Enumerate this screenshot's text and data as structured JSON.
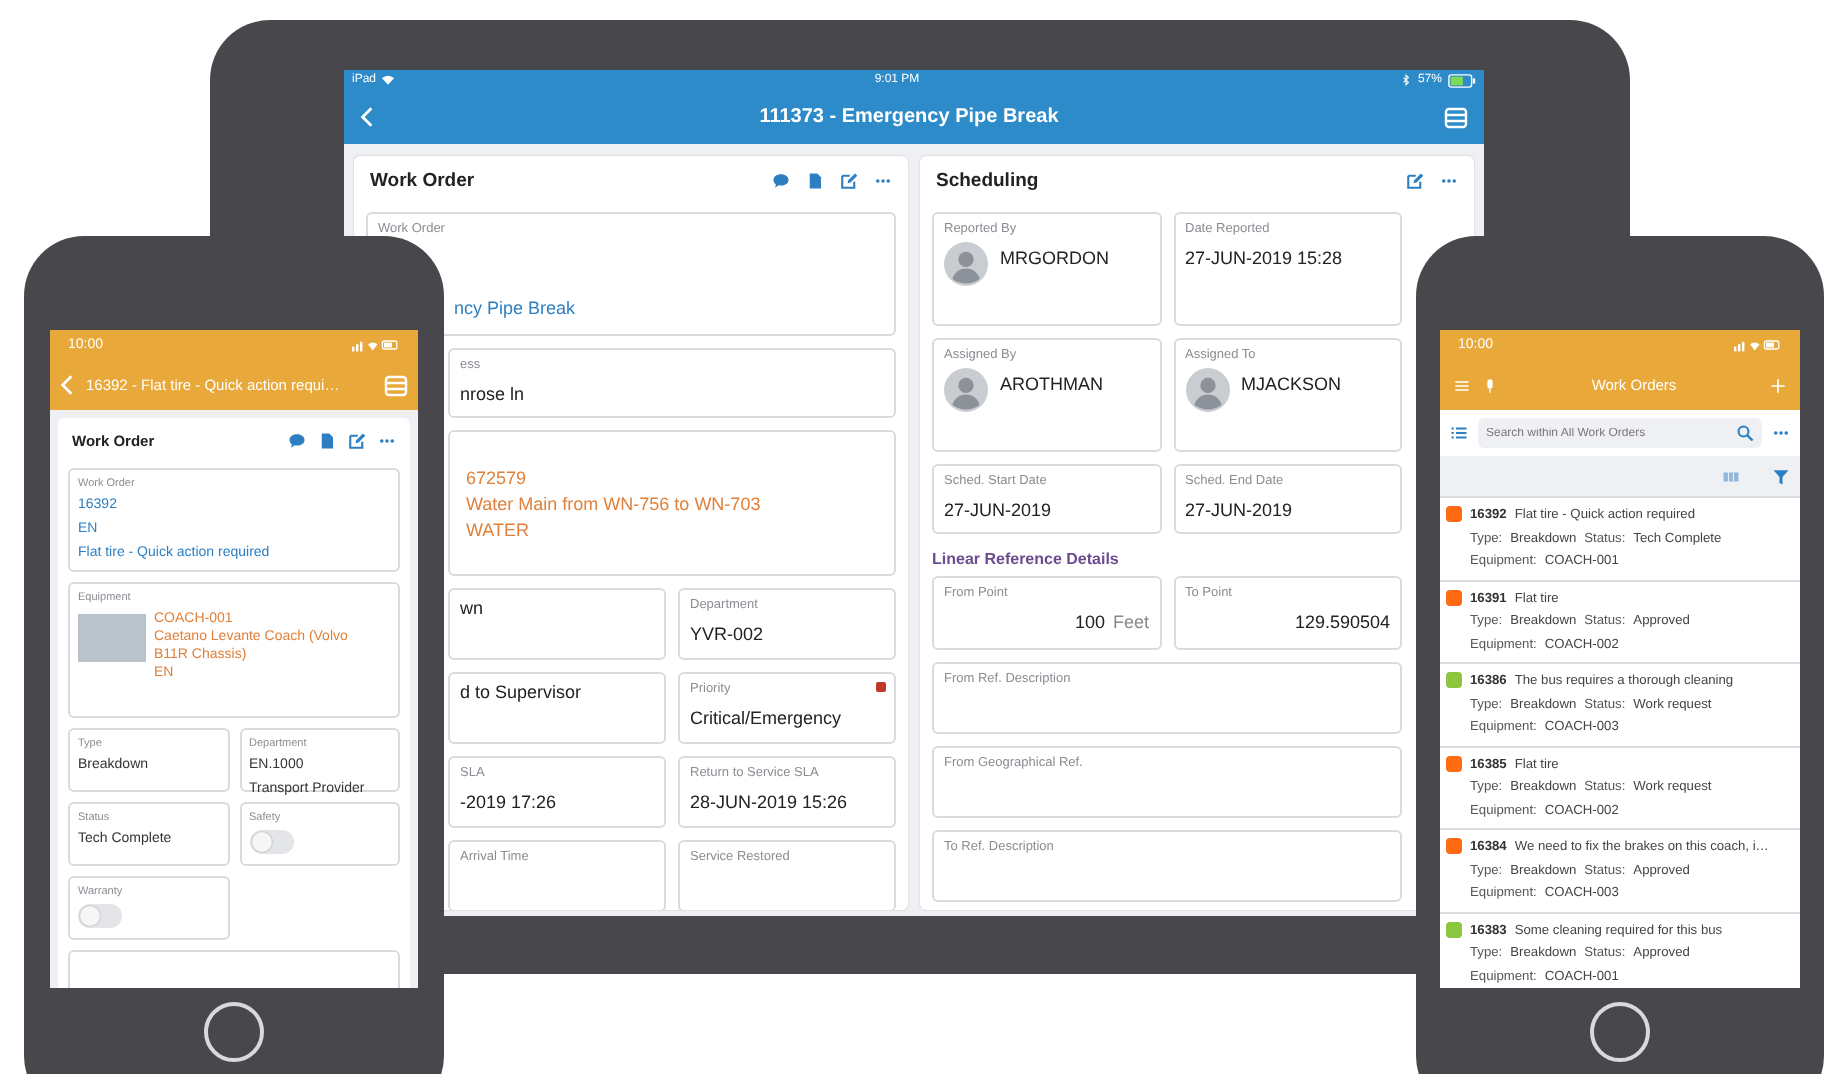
{
  "tablet": {
    "status_bar": {
      "carrier": "iPad",
      "time": "9:01 PM",
      "battery": "57%"
    },
    "title": "111373 - Emergency Pipe Break",
    "work_order_panel": {
      "title": "Work Order",
      "work_order": {
        "label": "Work Order",
        "value": "ncy Pipe Break"
      },
      "address": {
        "label": "ess",
        "value": "nrose ln"
      },
      "asset_lines": [
        "672579",
        "Water Main from WN-756 to WN-703",
        "WATER"
      ],
      "fields": [
        {
          "value": "wn"
        },
        {
          "label": "Department",
          "value": "YVR-002"
        },
        {
          "value": "d to Supervisor"
        },
        {
          "label": "Priority",
          "value": "Critical/Emergency",
          "flagged": true
        },
        {
          "label": "SLA",
          "value": "-2019 17:26"
        },
        {
          "label": "Return to Service SLA",
          "value": "28-JUN-2019 15:26"
        },
        {
          "label": "Arrival Time"
        },
        {
          "label": "Service Restored"
        }
      ]
    },
    "scheduling_panel": {
      "title": "Scheduling",
      "people": [
        {
          "label": "Reported By",
          "name": "MRGORDON"
        },
        {
          "label": "Date Reported",
          "value": "27-JUN-2019 15:28"
        },
        {
          "label": "Assigned By",
          "name": "AROTHMAN"
        },
        {
          "label": "Assigned To",
          "name": "MJACKSON"
        },
        {
          "label": "Sched. Start Date",
          "value": "27-JUN-2019"
        },
        {
          "label": "Sched. End Date",
          "value": "27-JUN-2019"
        }
      ],
      "section_title": "Linear Reference Details",
      "from_point": {
        "label": "From Point",
        "value": "100",
        "unit": "Feet"
      },
      "to_point": {
        "label": "To Point",
        "value": "129.590504"
      },
      "empty_fields": [
        "From Ref. Description",
        "From Geographical Ref.",
        "To Ref. Description"
      ]
    }
  },
  "left_phone": {
    "time": "10:00",
    "title": "16392 - Flat tire - Quick action requi…",
    "panel_title": "Work Order",
    "work_order": {
      "label": "Work Order",
      "lines": [
        "16392",
        "EN",
        "Flat tire - Quick action required"
      ]
    },
    "equipment": {
      "label": "Equipment",
      "lines": [
        "COACH-001",
        "Caetano Levante Coach (Volvo B11R Chassis)",
        "EN"
      ]
    },
    "fields": [
      {
        "label": "Type",
        "lines": [
          "Breakdown"
        ]
      },
      {
        "label": "Department",
        "lines": [
          "EN.1000",
          "Transport Provider"
        ]
      },
      {
        "label": "Status",
        "lines": [
          "Tech Complete"
        ]
      },
      {
        "label": "Safety",
        "kind": "toggle",
        "on": false
      },
      {
        "label": "Warranty",
        "kind": "toggle",
        "on": false
      }
    ]
  },
  "right_phone": {
    "time": "10:00",
    "title": "Work Orders",
    "search": {
      "placeholder": "Search within All Work Orders"
    },
    "items": [
      {
        "id": "16392",
        "title": "Flat tire - Quick action required",
        "type_label": "Type:",
        "type": "Breakdown",
        "status_label": "Status:",
        "status": "Tech Complete",
        "equipment_label": "Equipment:",
        "equipment": "COACH-001",
        "color": "#ff6a13"
      },
      {
        "id": "16391",
        "title": "Flat tire",
        "type_label": "Type:",
        "type": "Breakdown",
        "status_label": "Status:",
        "status": "Approved",
        "equipment_label": "Equipment:",
        "equipment": "COACH-002",
        "color": "#ff6a13"
      },
      {
        "id": "16386",
        "title": "The bus requires a thorough cleaning",
        "type_label": "Type:",
        "type": "Breakdown",
        "status_label": "Status:",
        "status": "Work request",
        "equipment_label": "Equipment:",
        "equipment": "COACH-003",
        "color": "#8cc63f"
      },
      {
        "id": "16385",
        "title": "Flat tire",
        "type_label": "Type:",
        "type": "Breakdown",
        "status_label": "Status:",
        "status": "Work request",
        "equipment_label": "Equipment:",
        "equipment": "COACH-002",
        "color": "#ff6a13"
      },
      {
        "id": "16384",
        "title": "We need to fix the brakes on this coach, i…",
        "type_label": "Type:",
        "type": "Breakdown",
        "status_label": "Status:",
        "status": "Approved",
        "equipment_label": "Equipment:",
        "equipment": "COACH-003",
        "color": "#ff6a13"
      },
      {
        "id": "16383",
        "title": "Some cleaning required for this bus",
        "type_label": "Type:",
        "type": "Breakdown",
        "status_label": "Status:",
        "status": "Approved",
        "equipment_label": "Equipment:",
        "equipment": "COACH-001",
        "color": "#8cc63f"
      }
    ]
  }
}
